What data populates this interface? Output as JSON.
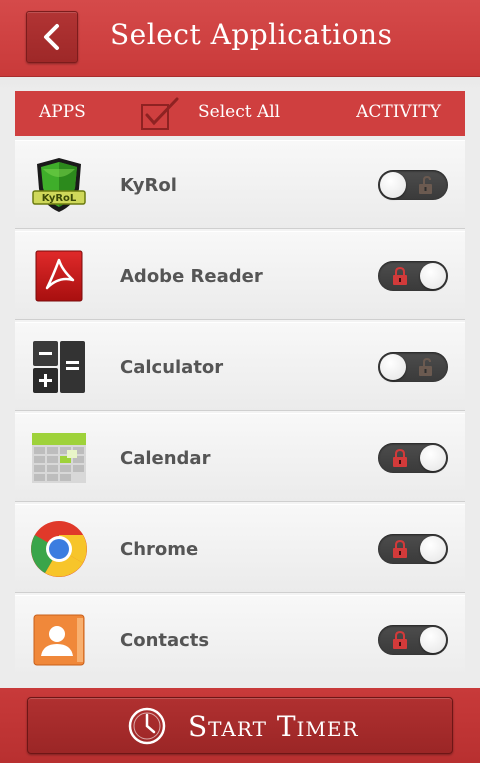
{
  "header": {
    "title": "Select Applications",
    "back_icon": "chevron-left-icon"
  },
  "columns": {
    "apps": "APPS",
    "select_all": "Select All",
    "activity": "ACTIVITY"
  },
  "apps": [
    {
      "name": "KyRol",
      "icon": "kyrol-shield-icon",
      "icon_text": "KyRoL",
      "locked": false
    },
    {
      "name": "Adobe Reader",
      "icon": "adobe-reader-icon",
      "locked": true
    },
    {
      "name": "Calculator",
      "icon": "calculator-icon",
      "locked": false
    },
    {
      "name": "Calendar",
      "icon": "calendar-icon",
      "locked": true
    },
    {
      "name": "Chrome",
      "icon": "chrome-icon",
      "locked": true
    },
    {
      "name": "Contacts",
      "icon": "contacts-icon",
      "locked": true
    }
  ],
  "footer": {
    "start_label": "Start Timer",
    "icon": "clock-icon"
  },
  "colors": {
    "brand_red": "#cf3f3f",
    "toggle_track": "#3f3f3f",
    "lock_on": "#d23a3a",
    "lock_off": "#6b5a50"
  }
}
